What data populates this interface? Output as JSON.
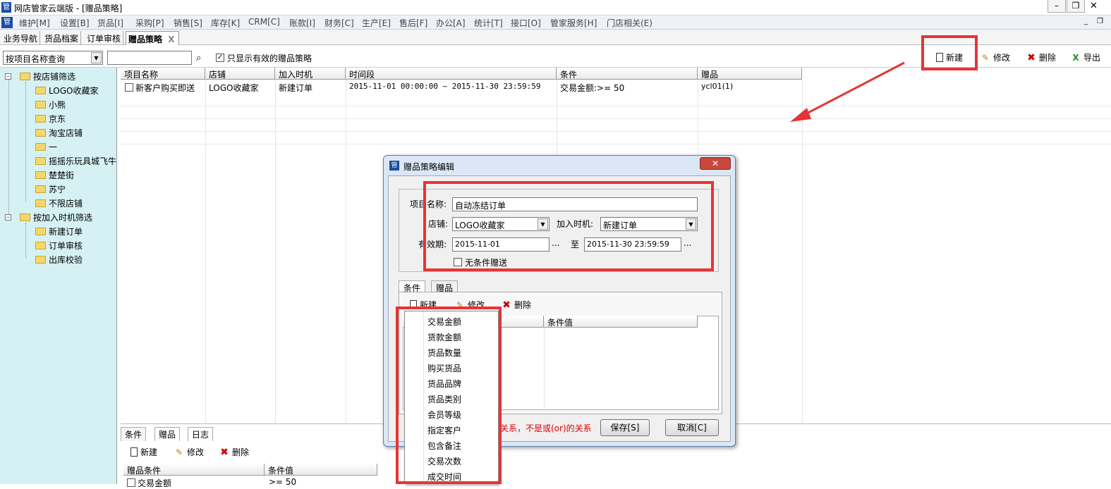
{
  "window": {
    "title": "网店管家云端版 - [赠品策略]",
    "app_icon": "管"
  },
  "menu": [
    "维护[M]",
    "设置[B]",
    "货品[I]",
    "采购[P]",
    "销售[S]",
    "库存[K]",
    "CRM[C]",
    "账款[I]",
    "财务[C]",
    "生产[E]",
    "售后[F]",
    "办公[A]",
    "统计[T]",
    "接口[O]",
    "管家服务[H]",
    "门店相关(E)"
  ],
  "doc_tabs": [
    "业务导航",
    "货品档案",
    "订单审核",
    "赠品策略"
  ],
  "doc_tab_close": "X",
  "toolbar": {
    "query_mode": "按项目名称查询",
    "search_value": "",
    "only_valid_label": "只显示有效的赠品策略",
    "only_valid_checked": "✓",
    "new": "新建",
    "edit": "修改",
    "delete": "删除",
    "export": "导出"
  },
  "tree": {
    "group1": "按店铺筛选",
    "shops": [
      "LOGO收藏家",
      "小熊",
      "京东",
      "淘宝店铺",
      "一",
      "摇摇乐玩具城飞牛",
      "楚楚街",
      "苏宁",
      "不限店铺"
    ],
    "group2": "按加入时机筛选",
    "timings": [
      "新建订单",
      "订单审核",
      "出库校验"
    ]
  },
  "grid": {
    "headers": [
      "项目名称",
      "店铺",
      "加入时机",
      "时间段",
      "条件",
      "赠品"
    ],
    "row": {
      "name": "新客户购买即送",
      "shop": "LOGO收藏家",
      "timing": "新建订单",
      "period": "2015-11-01 00:00:00 ~ 2015-11-30 23:59:59",
      "condition": "交易金额:>= 50",
      "gift": "ycl01(1)"
    }
  },
  "bottom": {
    "tabs": [
      "条件",
      "赠品",
      "日志"
    ],
    "new": "新建",
    "edit": "修改",
    "delete": "删除",
    "headers": [
      "赠品条件",
      "条件值"
    ],
    "row_name": "交易金额",
    "row_value": ">= 50"
  },
  "dialog": {
    "title": "赠品策略编辑",
    "name_label": "项目名称:",
    "name_value": "自动冻结订单",
    "shop_label": "店铺:",
    "shop_value": "LOGO收藏家",
    "timing_label": "加入时机:",
    "timing_value": "新建订单",
    "valid_label": "有效期:",
    "start_date": "2015-11-01",
    "to_label": "至",
    "end_date": "2015-11-30 23:59:59",
    "dots": "...",
    "unconditional_label": "无条件赠送",
    "tabs": [
      "条件",
      "赠品"
    ],
    "new": "新建",
    "edit": "修改",
    "delete": "删除",
    "col_value": "条件值",
    "note": "关系，不是或(or)的关系",
    "save": "保存[S]",
    "cancel": "取消[C]"
  },
  "condition_popup": [
    "交易金额",
    "货款金额",
    "货品数量",
    "购买货品",
    "货品品牌",
    "货品类别",
    "会员等级",
    "指定客户",
    "包含备注",
    "交易次数",
    "成交时间"
  ],
  "annotation_color": "#e53535"
}
